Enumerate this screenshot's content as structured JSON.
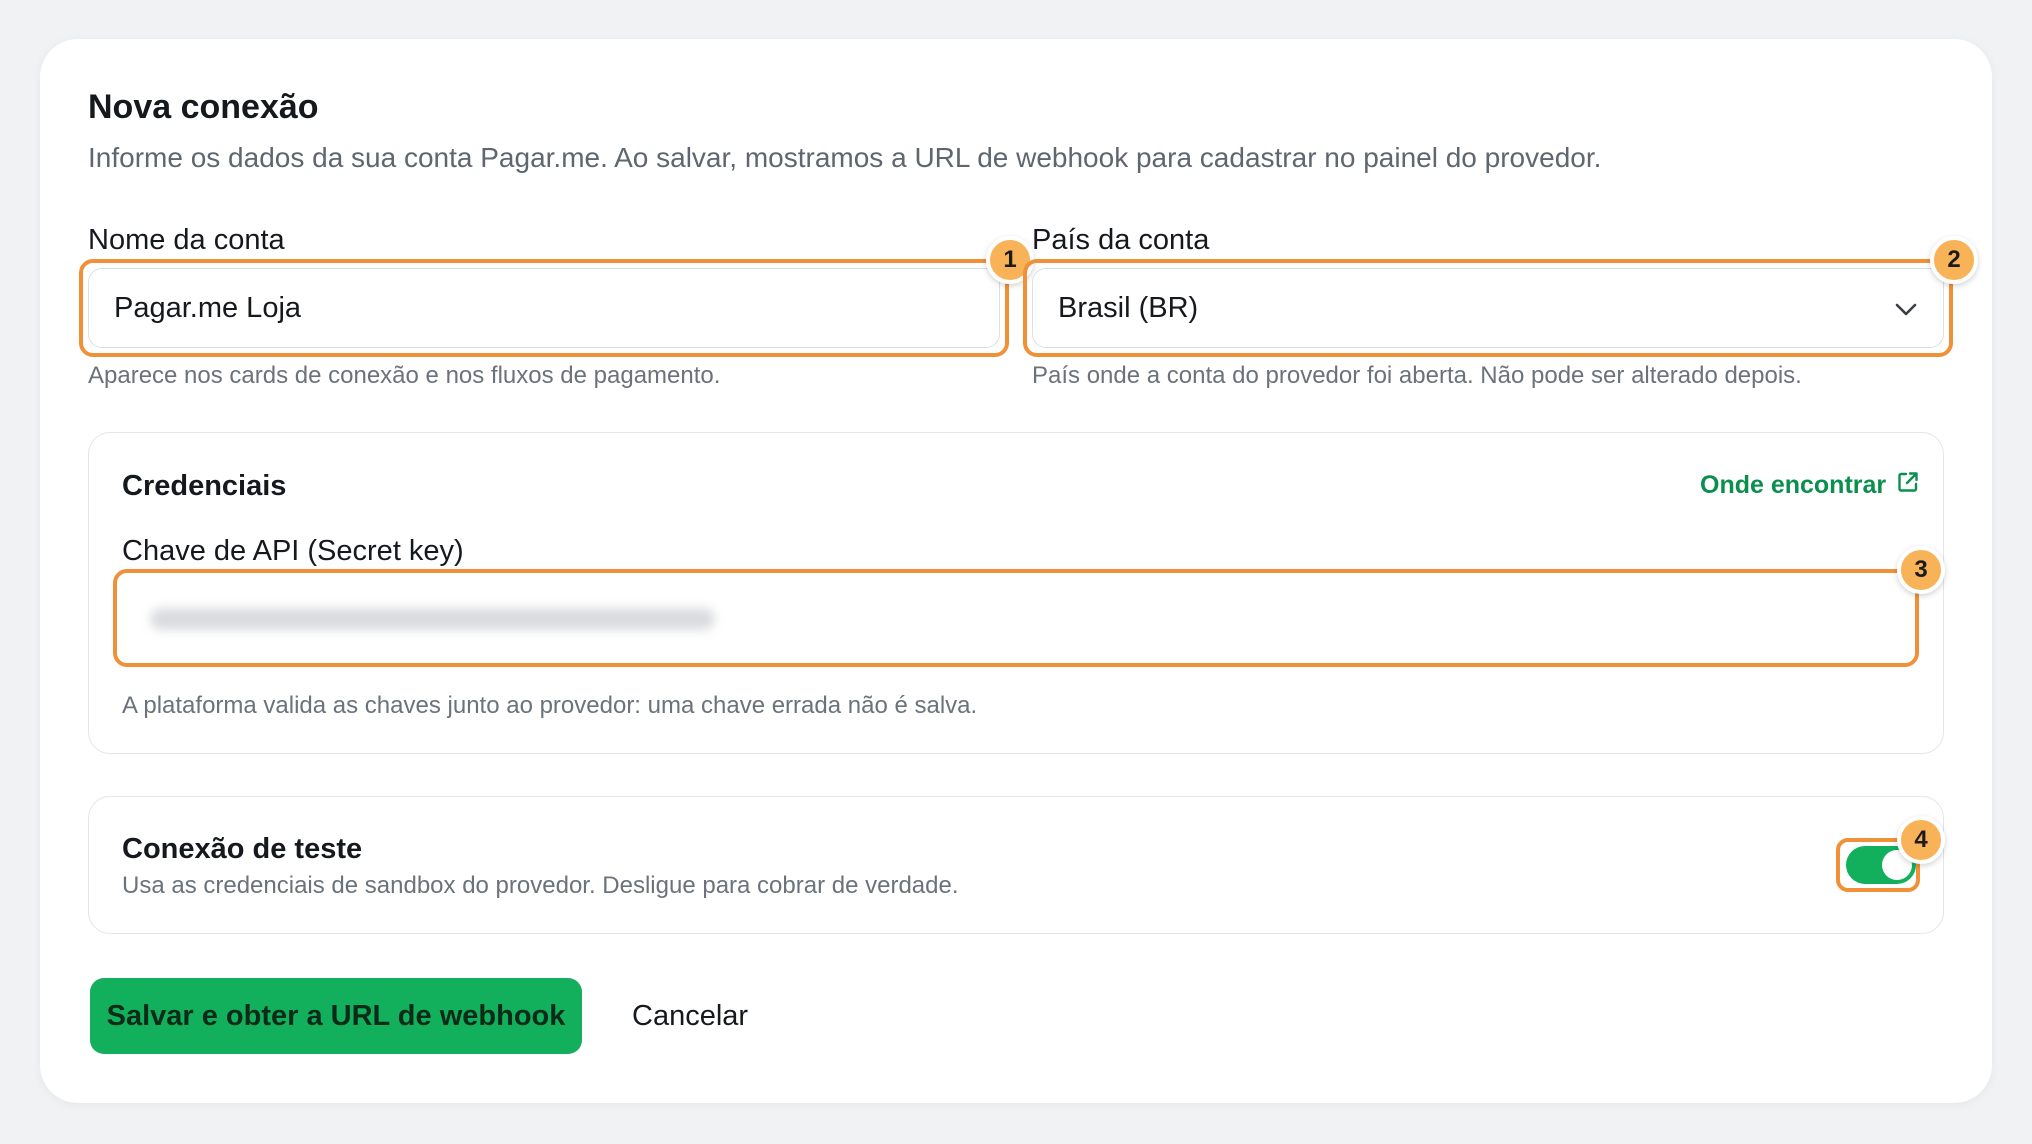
{
  "form": {
    "title": "Nova conexão",
    "subtitle": "Informe os dados da sua conta Pagar.me. Ao salvar, mostramos a URL de webhook para cadastrar no painel do provedor."
  },
  "account_name": {
    "label": "Nome da conta",
    "value": "Pagar.me Loja",
    "hint": "Aparece nos cards de conexão e nos fluxos de pagamento."
  },
  "account_country": {
    "label": "País da conta",
    "selected": "Brasil (BR)",
    "hint": "País onde a conta do provedor foi aberta. Não pode ser alterado depois."
  },
  "credentials": {
    "title": "Credenciais",
    "help_link": "Onde encontrar",
    "api_key_label": "Chave de API (Secret key)",
    "hint": "A plataforma valida as chaves junto ao provedor: uma chave errada não é salva."
  },
  "test_connection": {
    "title": "Conexão de teste",
    "description": "Usa as credenciais de sandbox do provedor. Desligue para cobrar de verdade.",
    "enabled": true
  },
  "actions": {
    "save_label": "Salvar e obter a URL de webhook",
    "cancel_label": "Cancelar"
  },
  "annotations": [
    "1",
    "2",
    "3",
    "4"
  ],
  "colors": {
    "accent_green": "#12b05c",
    "link_green": "#0a8f4f",
    "highlight_orange": "#f0913a",
    "badge_orange": "#f8b257"
  }
}
